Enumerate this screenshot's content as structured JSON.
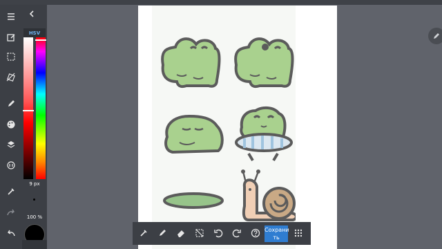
{
  "color_panel": {
    "mode_label": "HSV",
    "brush_size": "9 px",
    "opacity": "100 %",
    "current_color": "#000000"
  },
  "bottom_bar": {
    "save_label": "Сохрани ть"
  },
  "colors": {
    "toolbar_bg": "#3c3f45",
    "workspace_bg": "#60636b",
    "accent": "#2f7dd1",
    "frog_green": "#a9d18e",
    "outline": "#5b5b5b"
  },
  "icons": {
    "left_toolbar": [
      "menu-icon",
      "edit-icon",
      "selection-icon",
      "transform-icon",
      "pencil-icon",
      "palette-icon",
      "layers-icon",
      "adjust-icon",
      "eyedropper-icon",
      "redo-icon",
      "undo-icon"
    ],
    "bottom_bar": [
      "eyedropper-icon",
      "pencil-icon",
      "eraser-icon",
      "deselect-icon",
      "rotate-left-icon",
      "rotate-right-icon",
      "help-icon",
      "grid-icon"
    ]
  }
}
